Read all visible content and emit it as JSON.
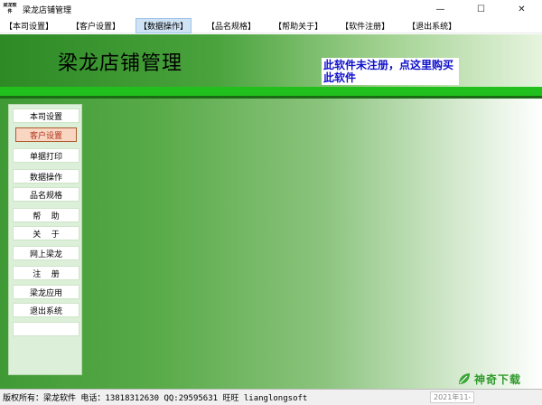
{
  "window": {
    "icon_text": "梁龙软件",
    "title": "梁龙店铺管理",
    "controls": {
      "minimize": "—",
      "maximize": "☐",
      "close": "✕"
    }
  },
  "menu": {
    "items": [
      {
        "label": "【本司设置】"
      },
      {
        "label": "【客户设置】"
      },
      {
        "label": "【数据操作】"
      },
      {
        "label": "【品名规格】"
      },
      {
        "label": "【帮助关于】"
      },
      {
        "label": "【软件注册】"
      },
      {
        "label": "【退出系统】"
      }
    ]
  },
  "header": {
    "app_title": "梁龙店铺管理",
    "register_notice": "此软件未注册，点这里购买此软件"
  },
  "sidebar": {
    "items": [
      {
        "label": "本司设置"
      },
      {
        "label": "客户设置"
      },
      {
        "label": "单据打印"
      },
      {
        "label": "数据操作"
      },
      {
        "label": "品名规格"
      },
      {
        "label": "帮    助"
      },
      {
        "label": "关    于"
      },
      {
        "label": "网上梁龙"
      },
      {
        "label": "注    册"
      },
      {
        "label": "梁龙应用"
      },
      {
        "label": "退出系统"
      }
    ]
  },
  "statusbar": {
    "text": "版权所有：梁龙软件 电话：13818312630 QQ:29595631 旺旺 lianglongsoft",
    "date": "2021年11-"
  },
  "watermark": {
    "text": "神奇下载"
  },
  "colors": {
    "accent_green": "#21c01c",
    "notice_blue": "#1010cc",
    "active_item": "#b0301a"
  }
}
